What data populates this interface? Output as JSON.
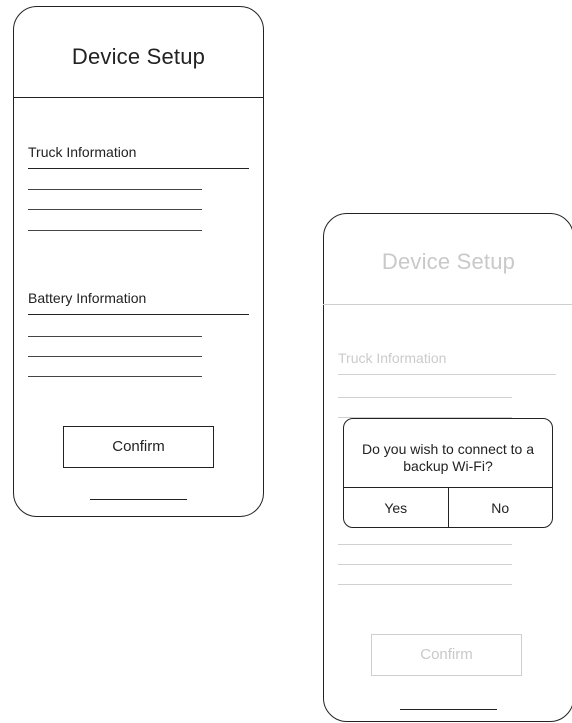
{
  "screen_setup": {
    "title": "Device Setup",
    "truck_section_label": "Truck Information",
    "battery_section_label": "Battery Information",
    "confirm_label": "Confirm"
  },
  "screen_dialog": {
    "title": "Device Setup",
    "truck_section_label": "Truck Information",
    "confirm_label": "Confirm",
    "dialog": {
      "message": "Do you wish to connect to a backup Wi-Fi?",
      "yes_label": "Yes",
      "no_label": "No"
    }
  }
}
